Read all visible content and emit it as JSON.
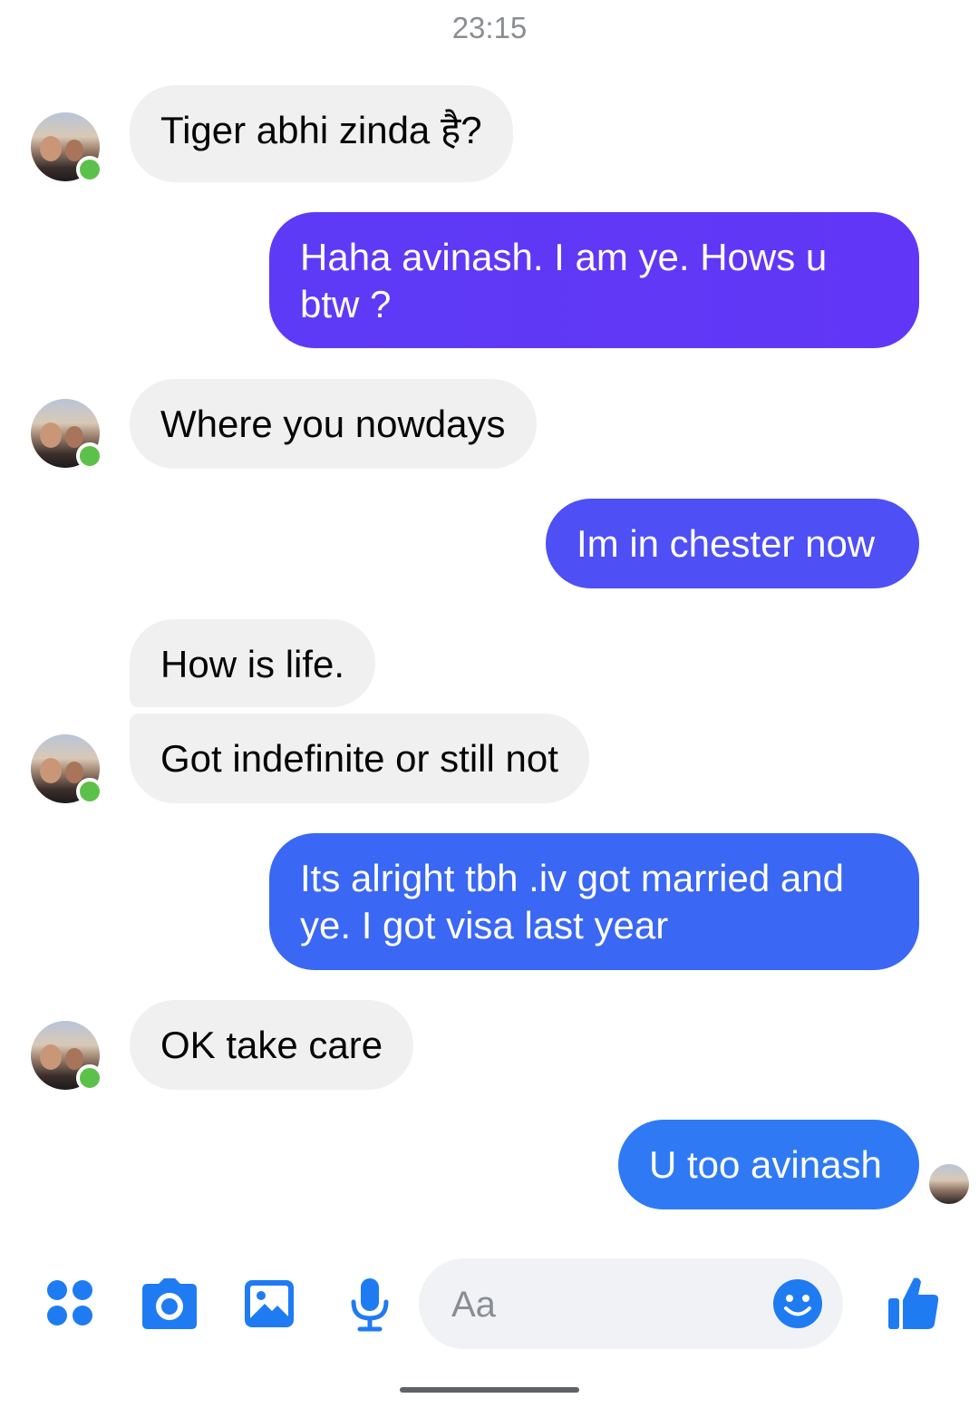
{
  "timestamp": "23:15",
  "messages": [
    {
      "sender": "contact",
      "text": "Tiger abhi zinda है?"
    },
    {
      "sender": "me",
      "text": "Haha avinash. I am ye. Hows u btw ?"
    },
    {
      "sender": "contact",
      "text": "Where you nowdays"
    },
    {
      "sender": "me",
      "text": "Im in chester now"
    },
    {
      "sender": "contact",
      "text": "How is life."
    },
    {
      "sender": "contact",
      "text": "Got indefinite or still not"
    },
    {
      "sender": "me",
      "text": "Its alright tbh .iv got married and ye. I got visa last year"
    },
    {
      "sender": "contact",
      "text": "OK take care"
    },
    {
      "sender": "me",
      "text": "U too avinash"
    }
  ],
  "colors": {
    "incoming_bubble": "#f0f0f0",
    "outgoing_1": "#6236f6",
    "outgoing_2": "#4e4ff4",
    "outgoing_3": "#3a67f3",
    "outgoing_4": "#2f7af4",
    "presence": "#5cc14a",
    "accent": "#1f7bf2"
  },
  "composer": {
    "placeholder": "Aa"
  },
  "icons": [
    "menu-dots-icon",
    "camera-icon",
    "gallery-icon",
    "microphone-icon",
    "emoji-icon",
    "thumbs-up-icon"
  ]
}
